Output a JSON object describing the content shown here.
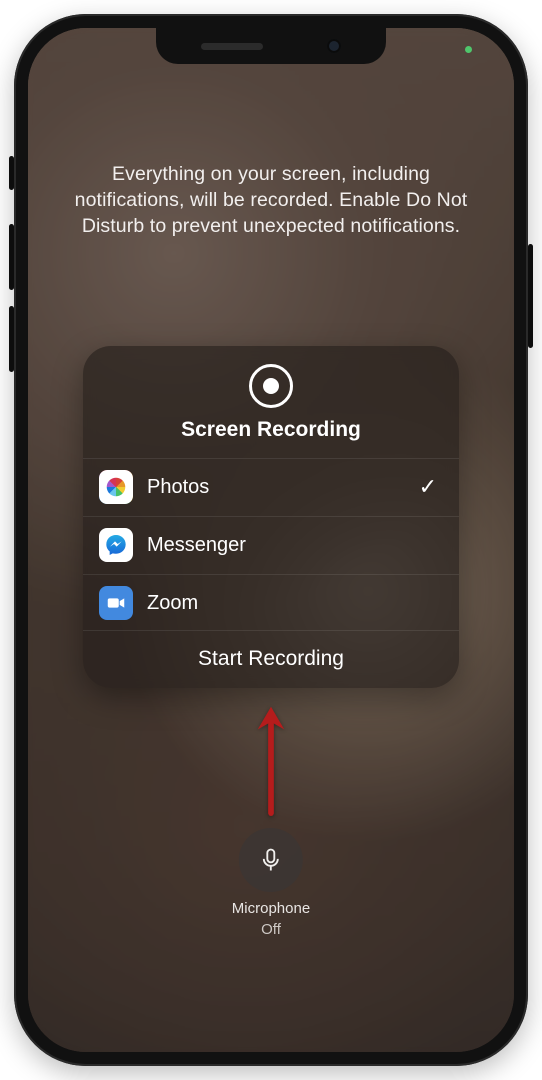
{
  "notice_text": "Everything on your screen, including notifications, will be recorded. Enable Do Not Disturb to prevent unexpected notifications.",
  "panel": {
    "title": "Screen Recording",
    "apps": [
      {
        "label": "Photos",
        "selected": true,
        "icon": "photos-icon"
      },
      {
        "label": "Messenger",
        "selected": false,
        "icon": "messenger-icon"
      },
      {
        "label": "Zoom",
        "selected": false,
        "icon": "zoom-icon"
      }
    ],
    "start_label": "Start Recording"
  },
  "mic": {
    "label": "Microphone",
    "state": "Off"
  }
}
